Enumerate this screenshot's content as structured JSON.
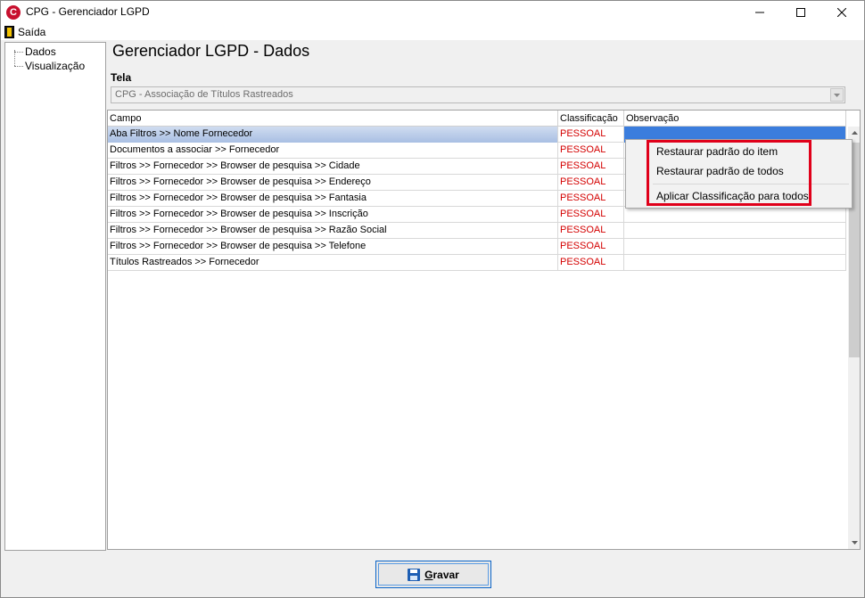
{
  "window": {
    "title": "CPG - Gerenciador LGPD"
  },
  "menu": {
    "exit_label": "Saída"
  },
  "tree": {
    "items": [
      {
        "label": "Dados"
      },
      {
        "label": "Visualização"
      }
    ]
  },
  "main": {
    "page_title": "Gerenciador LGPD - Dados",
    "tela_label": "Tela",
    "tela_value": "CPG - Associação de Títulos Rastreados"
  },
  "grid": {
    "columns": {
      "campo": "Campo",
      "classificacao": "Classificação",
      "observacao": "Observação"
    },
    "rows": [
      {
        "campo": "Aba Filtros >> Nome Fornecedor",
        "classificacao": "PESSOAL",
        "observacao": ""
      },
      {
        "campo": "Documentos a associar >> Fornecedor",
        "classificacao": "PESSOAL",
        "observacao": ""
      },
      {
        "campo": "Filtros >> Fornecedor  >> Browser de pesquisa >> Cidade",
        "classificacao": "PESSOAL",
        "observacao": ""
      },
      {
        "campo": "Filtros >> Fornecedor  >> Browser de pesquisa >> Endereço",
        "classificacao": "PESSOAL",
        "observacao": ""
      },
      {
        "campo": "Filtros >> Fornecedor  >> Browser de pesquisa >> Fantasia",
        "classificacao": "PESSOAL",
        "observacao": ""
      },
      {
        "campo": "Filtros >> Fornecedor  >> Browser de pesquisa >> Inscrição",
        "classificacao": "PESSOAL",
        "observacao": ""
      },
      {
        "campo": "Filtros >> Fornecedor  >> Browser de pesquisa >> Razão Social",
        "classificacao": "PESSOAL",
        "observacao": ""
      },
      {
        "campo": "Filtros >> Fornecedor  >> Browser de pesquisa >> Telefone",
        "classificacao": "PESSOAL",
        "observacao": ""
      },
      {
        "campo": "Títulos Rastreados >> Fornecedor",
        "classificacao": "PESSOAL",
        "observacao": ""
      }
    ],
    "selected_row": 0
  },
  "context_menu": {
    "items": [
      {
        "label": "Restaurar padrão do item"
      },
      {
        "label": "Restaurar padrão de todos"
      },
      {
        "label": "Aplicar Classificação para todos"
      }
    ]
  },
  "footer": {
    "save_label_first": "G",
    "save_label_rest": "ravar"
  },
  "colors": {
    "classification_text": "#d40000",
    "highlight_border": "#e0001a",
    "selection": "#3b7ddd"
  },
  "icons": {
    "app": "cpg-logo-icon",
    "exit": "exit-door-icon",
    "save": "floppy-disk-icon"
  }
}
